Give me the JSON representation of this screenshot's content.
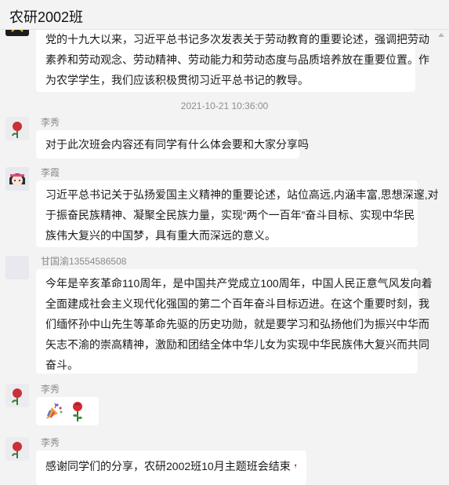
{
  "window": {
    "title": "农研2002班"
  },
  "messages": {
    "m0": {
      "lines": [
        "党的十九大以来，习近平总书记多次发表关于劳动教育的重要论述，强调把劳动",
        "素养和劳动观念、劳动精神、劳动能力和劳动态度与品质培养放在重要位置。作",
        "为农学学生，我们应该积极贯彻习近平总书记的教导。"
      ]
    },
    "timestamp": "2021-10-21 10:36:00",
    "m1": {
      "sender": "李秀",
      "lines": [
        "对于此次班会内容还有同学有什么体会要和大家分享吗"
      ]
    },
    "m2": {
      "sender": "李霞",
      "lines": [
        "习近平总书记关于弘扬爱国主义精神的重要论述，站位高远,内涵丰富,思想深邃,对",
        "于振奋民族精神、凝聚全民族力量，实现“两个一百年”奋斗目标、实现中华民",
        "族伟大复兴的中国梦，具有重大而深远的意义。"
      ]
    },
    "m3": {
      "sender": "甘国渝13554586508",
      "lines": [
        "今年是辛亥革命110周年，是中国共产党成立100周年，中国人民正意气风发向着",
        "全面建成社会主义现代化强国的第二个百年奋斗目标迈进。在这个重要时刻，我",
        "们缅怀孙中山先生等革命先驱的历史功勋，就是要学习和弘扬他们为振兴中华而",
        "矢志不渝的崇高精神，激励和团结全体中华儿女为实现中华民族伟大复兴而共同",
        "奋斗。"
      ]
    },
    "m4": {
      "sender": "李秀",
      "emojis": [
        "party-popper-icon",
        "rose-icon"
      ]
    },
    "m5": {
      "sender": "李秀",
      "text": "感谢同学们的分享，农研2002班10月主题班会结束"
    }
  }
}
